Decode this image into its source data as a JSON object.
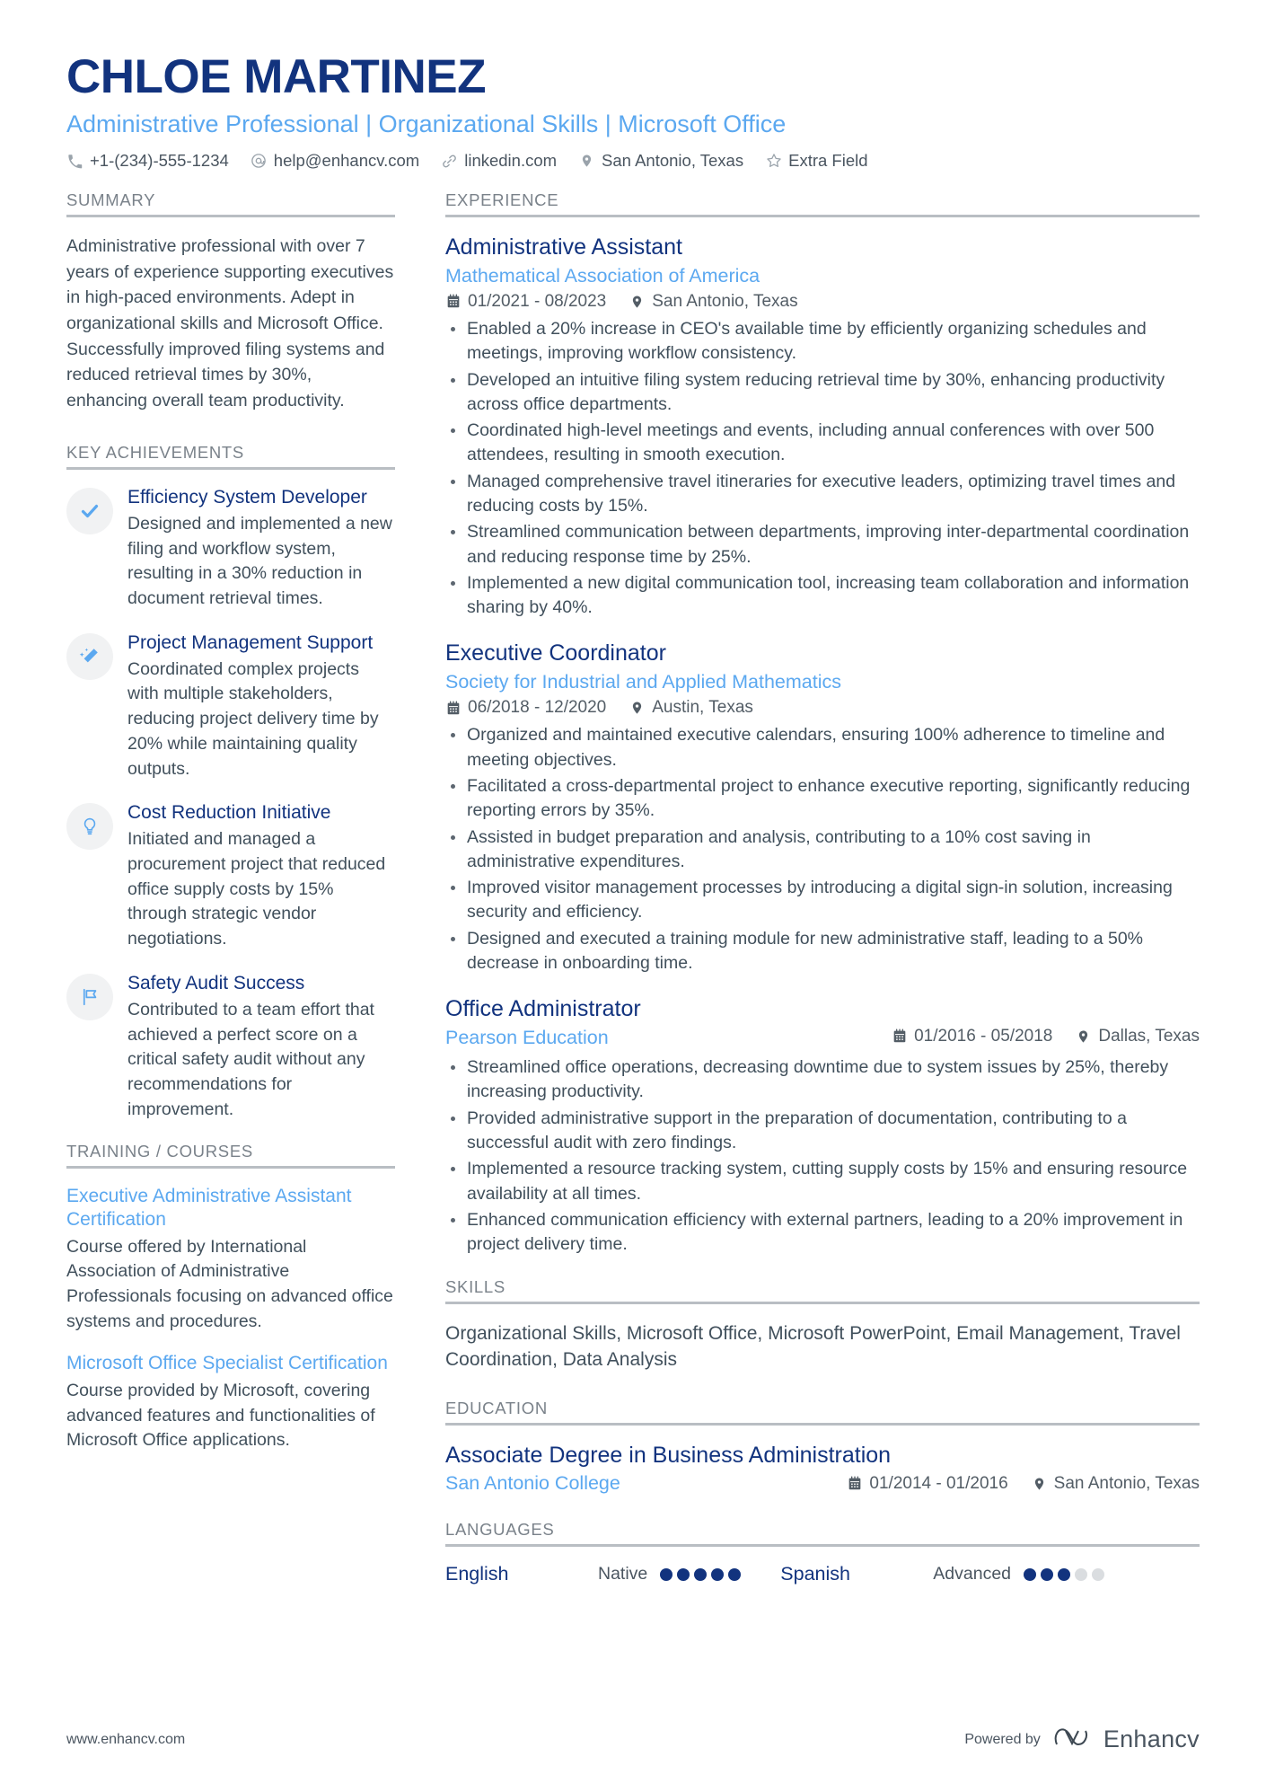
{
  "header": {
    "name": "CHLOE MARTINEZ",
    "headline": "Administrative Professional | Organizational Skills | Microsoft Office",
    "contacts": [
      {
        "icon": "phone-icon",
        "text": "+1-(234)-555-1234"
      },
      {
        "icon": "email-icon",
        "text": "help@enhancv.com"
      },
      {
        "icon": "link-icon",
        "text": "linkedin.com"
      },
      {
        "icon": "location-pin-icon",
        "text": "San Antonio, Texas"
      },
      {
        "icon": "star-icon",
        "text": "Extra Field"
      }
    ]
  },
  "sections": {
    "summary_title": "SUMMARY",
    "key_achievements_title": "KEY ACHIEVEMENTS",
    "training_title": "TRAINING / COURSES",
    "experience_title": "EXPERIENCE",
    "skills_title": "SKILLS",
    "education_title": "EDUCATION",
    "languages_title": "LANGUAGES"
  },
  "summary": {
    "text": "Administrative professional with over 7 years of experience supporting executives in high-paced environments. Adept in organizational skills and Microsoft Office. Successfully improved filing systems and reduced retrieval times by 30%, enhancing overall team productivity."
  },
  "key_achievements": [
    {
      "icon": "check-icon",
      "title": "Efficiency System Developer",
      "description": "Designed and implemented a new filing and workflow system, resulting in a 30% reduction in document retrieval times."
    },
    {
      "icon": "magic-wand-icon",
      "title": "Project Management Support",
      "description": "Coordinated complex projects with multiple stakeholders, reducing project delivery time by 20% while maintaining quality outputs."
    },
    {
      "icon": "lightbulb-icon",
      "title": "Cost Reduction Initiative",
      "description": "Initiated and managed a procurement project that reduced office supply costs by 15% through strategic vendor negotiations."
    },
    {
      "icon": "flag-icon",
      "title": "Safety Audit Success",
      "description": "Contributed to a team effort that achieved a perfect score on a critical safety audit without any recommendations for improvement."
    }
  ],
  "training_courses": [
    {
      "title": "Executive Administrative Assistant Certification",
      "description": "Course offered by International Association of Administrative Professionals focusing on advanced office systems and procedures."
    },
    {
      "title": "Microsoft Office Specialist Certification",
      "description": "Course provided by Microsoft, covering advanced features and functionalities of Microsoft Office applications."
    }
  ],
  "experience": [
    {
      "title": "Administrative Assistant",
      "company": "Mathematical Association of America",
      "dates": "01/2021 - 08/2023",
      "location": "San Antonio, Texas",
      "layout": "stacked",
      "bullets": [
        "Enabled a 20% increase in CEO's available time by efficiently organizing schedules and meetings, improving workflow consistency.",
        "Developed an intuitive filing system reducing retrieval time by 30%, enhancing productivity across office departments.",
        "Coordinated high-level meetings and events, including annual conferences with over 500 attendees, resulting in smooth execution.",
        "Managed comprehensive travel itineraries for executive leaders, optimizing travel times and reducing costs by 15%.",
        "Streamlined communication between departments, improving inter-departmental coordination and reducing response time by 25%.",
        "Implemented a new digital communication tool, increasing team collaboration and information sharing by 40%."
      ]
    },
    {
      "title": "Executive Coordinator",
      "company": "Society for Industrial and Applied Mathematics",
      "dates": "06/2018 - 12/2020",
      "location": "Austin, Texas",
      "layout": "stacked",
      "bullets": [
        "Organized and maintained executive calendars, ensuring 100% adherence to timeline and meeting objectives.",
        "Facilitated a cross-departmental project to enhance executive reporting, significantly reducing reporting errors by 35%.",
        "Assisted in budget preparation and analysis, contributing to a 10% cost saving in administrative expenditures.",
        "Improved visitor management processes by introducing a digital sign-in solution, increasing security and efficiency.",
        "Designed and executed a training module for new administrative staff, leading to a 50% decrease in onboarding time."
      ]
    },
    {
      "title": "Office Administrator",
      "company": "Pearson Education",
      "dates": "01/2016 - 05/2018",
      "location": "Dallas, Texas",
      "layout": "inline",
      "bullets": [
        "Streamlined office operations, decreasing downtime due to system issues by 25%, thereby increasing productivity.",
        "Provided administrative support in the preparation of documentation, contributing to a successful audit with zero findings.",
        "Implemented a resource tracking system, cutting supply costs by 15% and ensuring resource availability at all times.",
        "Enhanced communication efficiency with external partners, leading to a 20% improvement in project delivery time."
      ]
    }
  ],
  "skills": {
    "text": "Organizational Skills, Microsoft Office, Microsoft PowerPoint, Email Management, Travel Coordination, Data Analysis"
  },
  "education": [
    {
      "degree": "Associate Degree in Business Administration",
      "school": "San Antonio College",
      "dates": "01/2014 - 01/2016",
      "location": "San Antonio, Texas"
    }
  ],
  "languages": [
    {
      "name": "English",
      "level": "Native",
      "filled": 5,
      "total": 5
    },
    {
      "name": "Spanish",
      "level": "Advanced",
      "filled": 3,
      "total": 5
    }
  ],
  "footer": {
    "site": "www.enhancv.com",
    "powered_by": "Powered by",
    "brand": "Enhancv"
  },
  "colors": {
    "navy": "#12337e",
    "accent_blue": "#5ba8f0",
    "body_text": "#41505c",
    "muted": "#7a828a",
    "rule": "#b9bec3",
    "badge_bg": "#f1f2f3",
    "dot_off": "#dadde0"
  }
}
